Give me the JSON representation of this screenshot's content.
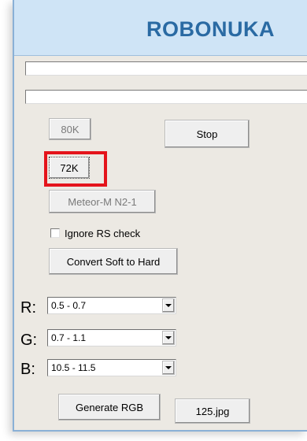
{
  "banner": {
    "title": "ROBONUKA"
  },
  "buttons": {
    "b80k": "80K",
    "stop": "Stop",
    "b72k": "72K",
    "meteor": "Meteor-M N2-1",
    "convert": "Convert Soft to Hard",
    "generate_rgb": "Generate RGB",
    "image_file": "125.jpg"
  },
  "ignore_rs": {
    "label": "Ignore RS check",
    "checked": false
  },
  "channels": [
    {
      "label": "R:",
      "value": "0.5 - 0.7"
    },
    {
      "label": "G:",
      "value": "0.7 - 1.1"
    },
    {
      "label": "B:",
      "value": "10.5 - 11.5"
    }
  ],
  "colors": {
    "banner_bg": "#cfe4f6",
    "title": "#2a6aa3",
    "highlight": "#e4141b"
  }
}
